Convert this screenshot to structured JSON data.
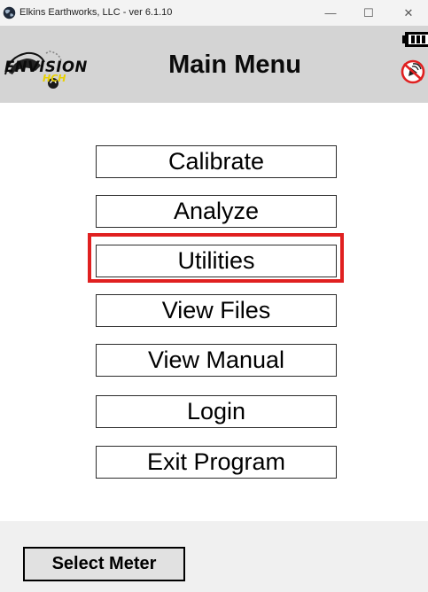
{
  "window": {
    "title": "Elkins Earthworks, LLC - ver 6.1.10",
    "controls": {
      "minimize": "—",
      "maximize": "☐",
      "close": "✕"
    }
  },
  "header": {
    "logo_text": "ENVISION",
    "logo_subtext": "HCH",
    "title": "Main Menu",
    "status_icons": [
      "battery-icon",
      "gps-disconnected-icon"
    ]
  },
  "menu": {
    "items": [
      {
        "label": "Calibrate"
      },
      {
        "label": "Analyze"
      },
      {
        "label": "Utilities",
        "highlighted": true
      },
      {
        "label": "View Files"
      },
      {
        "label": "View Manual"
      },
      {
        "label": "Login"
      },
      {
        "label": "Exit Program"
      }
    ]
  },
  "footer": {
    "select_meter_label": "Select Meter"
  },
  "colors": {
    "header_bg": "#d4d4d4",
    "highlight": "#e02020",
    "logo_accent": "#e8d000",
    "footer_bg": "#f0f0f0"
  }
}
